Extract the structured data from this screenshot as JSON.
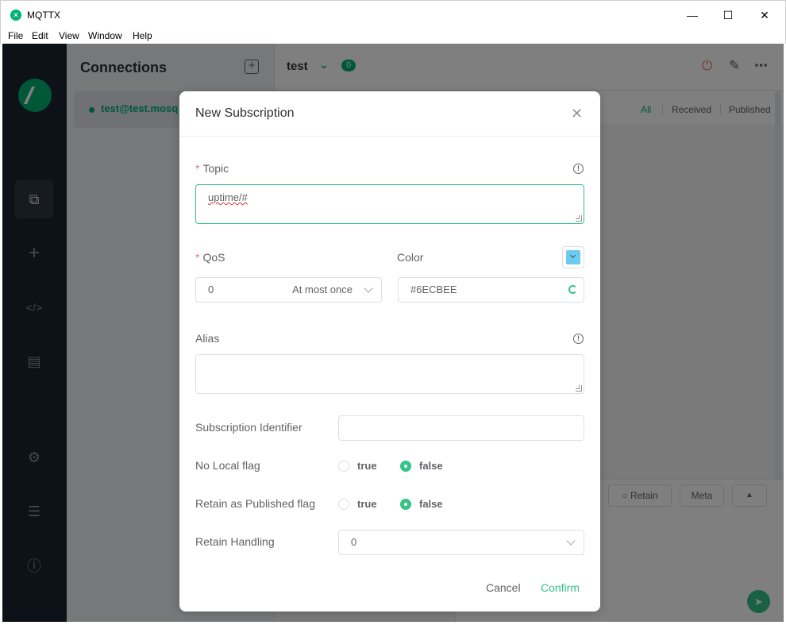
{
  "window": {
    "title": "MQTTX",
    "menu": [
      "File",
      "Edit",
      "View",
      "Window",
      "Help"
    ]
  },
  "sidebar": {
    "title": "Connections",
    "connections": [
      {
        "name": "test@test.mosq",
        "status": "connected"
      }
    ]
  },
  "main": {
    "title": "test",
    "message_count": "0",
    "filters": [
      "All",
      "Received",
      "Published"
    ],
    "active_filter": "All",
    "send_bar": {
      "retain_label": "Retain",
      "meta_label": "Meta"
    }
  },
  "dialog": {
    "title": "New Subscription",
    "topic": {
      "label": "Topic",
      "value": "uptime/#",
      "required": true
    },
    "qos": {
      "label": "QoS",
      "value": "0",
      "description": "At most once",
      "required": true
    },
    "color": {
      "label": "Color",
      "value": "#6ECBEE",
      "swatch": "#6ECBEE"
    },
    "alias": {
      "label": "Alias",
      "value": ""
    },
    "subscription_identifier": {
      "label": "Subscription Identifier",
      "value": ""
    },
    "no_local": {
      "label": "No Local flag",
      "options": [
        "true",
        "false"
      ],
      "selected": "false"
    },
    "retain_as_published": {
      "label": "Retain as Published flag",
      "options": [
        "true",
        "false"
      ],
      "selected": "false"
    },
    "retain_handling": {
      "label": "Retain Handling",
      "value": "0"
    },
    "cancel_label": "Cancel",
    "confirm_label": "Confirm"
  },
  "colors": {
    "accent": "#00b173",
    "nav_bg": "#1b2530"
  }
}
